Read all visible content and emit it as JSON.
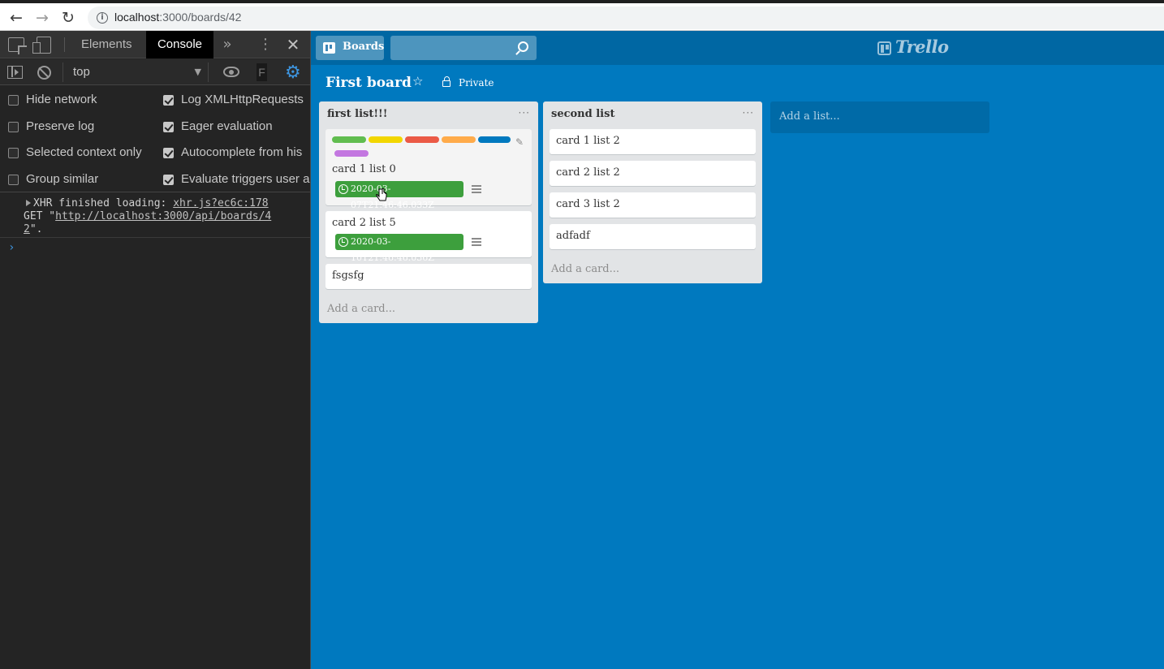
{
  "browser": {
    "url_host": "localhost",
    "url_path": ":3000/boards/42"
  },
  "devtools": {
    "tabs": [
      "Elements",
      "Console"
    ],
    "context": "top",
    "filter_char": "F",
    "options_left": [
      {
        "label": "Hide network",
        "checked": false
      },
      {
        "label": "Preserve log",
        "checked": false
      },
      {
        "label": "Selected context only",
        "checked": false
      },
      {
        "label": "Group similar",
        "checked": false
      }
    ],
    "options_right": [
      {
        "label": "Log XMLHttpRequests",
        "checked": true
      },
      {
        "label": "Eager evaluation",
        "checked": true
      },
      {
        "label": "Autocomplete from his",
        "checked": true
      },
      {
        "label": "Evaluate triggers user a",
        "checked": true
      }
    ],
    "log": {
      "prefix": "XHR finished loading: ",
      "source": "xhr.js?ec6c:178",
      "method": "GET \"",
      "url_a": "http://localhost:3000/api/boards/4",
      "url_b": "2",
      "suffix": "\"."
    },
    "prompt": "›"
  },
  "header": {
    "boards_label": "Boards",
    "logo_text": "Trello"
  },
  "board": {
    "title": "First board",
    "privacy": "Private"
  },
  "lists": [
    {
      "title": "first list!!!",
      "menu": "···",
      "cards": [
        {
          "text": "card 1 list 0",
          "due": "2020-03-07T21:46:46.033Z"
        },
        {
          "text": "card 2 list 5",
          "due": "2020-03-10T21:46:46.036Z"
        },
        {
          "text": "fsgsfg"
        }
      ],
      "add_card": "Add a card..."
    },
    {
      "title": "second list",
      "menu": "···",
      "cards": [
        {
          "text": "card 1 list 2"
        },
        {
          "text": "card 2 list 2"
        },
        {
          "text": "card 3 list 2"
        },
        {
          "text": "adfadf"
        }
      ],
      "add_card": "Add a card..."
    }
  ],
  "add_list": "Add a list...",
  "label_colors": [
    "#61bd4f",
    "#f2d600",
    "#eb5a46",
    "#ffab4a",
    "#0079bf",
    "#c377e0"
  ]
}
